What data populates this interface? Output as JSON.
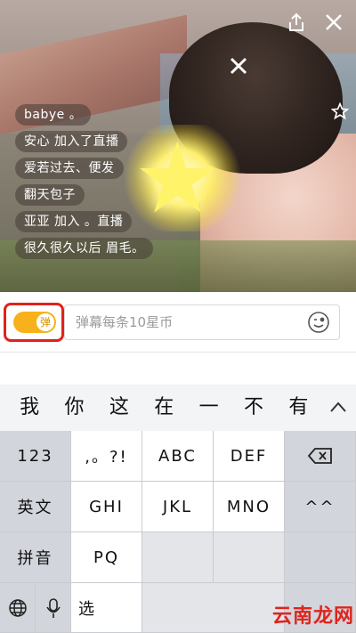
{
  "chat": {
    "messages": [
      "babye 。",
      "安心 加入了直播",
      "爱若过去、便发",
      "翻天包子",
      "亚亚 加入 。直播",
      "很久很久以后 眉毛。"
    ]
  },
  "overlay": {
    "share_icon": "share-icon",
    "close_icon": "close-icon",
    "favorite_icon": "star-outline-icon"
  },
  "input_bar": {
    "danmaku_toggle_label": "弹",
    "placeholder": "弹幕每条10星币",
    "emoji_icon": "smiley-icon",
    "accent_color": "#f7b11a",
    "highlight_color": "#e2211c"
  },
  "keyboard": {
    "candidates": [
      "我",
      "你",
      "这",
      "在",
      "一",
      "不",
      "有"
    ],
    "candidates_expand": "∧",
    "row1": [
      "123",
      ",。?!",
      "ABC",
      "DEF",
      "⌫"
    ],
    "row2": [
      "英文",
      "GHI",
      "JKL",
      "MNO",
      "^^"
    ],
    "row3": [
      "拼音",
      "PQ",
      "",
      "",
      ""
    ],
    "row4": [
      "",
      "",
      "选"
    ]
  },
  "watermark": {
    "text": "云南龙网"
  }
}
